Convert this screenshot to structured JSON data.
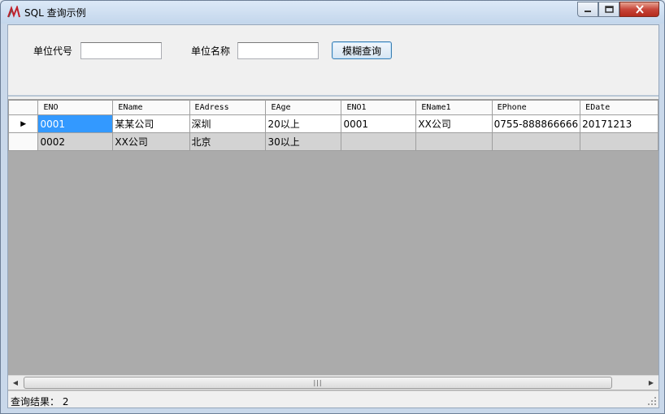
{
  "window": {
    "title": "SQL 查询示例",
    "min_icon": "minimize-icon",
    "max_icon": "maximize-icon",
    "close_icon": "close-icon"
  },
  "query": {
    "unit_code_label": "单位代号",
    "unit_code_value": "",
    "unit_name_label": "单位名称",
    "unit_name_value": "",
    "search_button": "模糊查询"
  },
  "grid": {
    "columns": [
      "ENO",
      "EName",
      "EAdress",
      "EAge",
      "ENO1",
      "EName1",
      "EPhone",
      "EDate"
    ],
    "rows": [
      [
        "0001",
        "某某公司",
        "深圳",
        "20以上",
        "0001",
        "XX公司",
        "0755-888866666",
        "20171213"
      ],
      [
        "0002",
        "XX公司",
        "北京",
        "30以上",
        "",
        "",
        "",
        ""
      ]
    ],
    "current_row_marker": "▶"
  },
  "status": {
    "label": "查询结果：",
    "count": "2"
  },
  "colors": {
    "selection": "#3399ff",
    "grid_background": "#ababab"
  }
}
